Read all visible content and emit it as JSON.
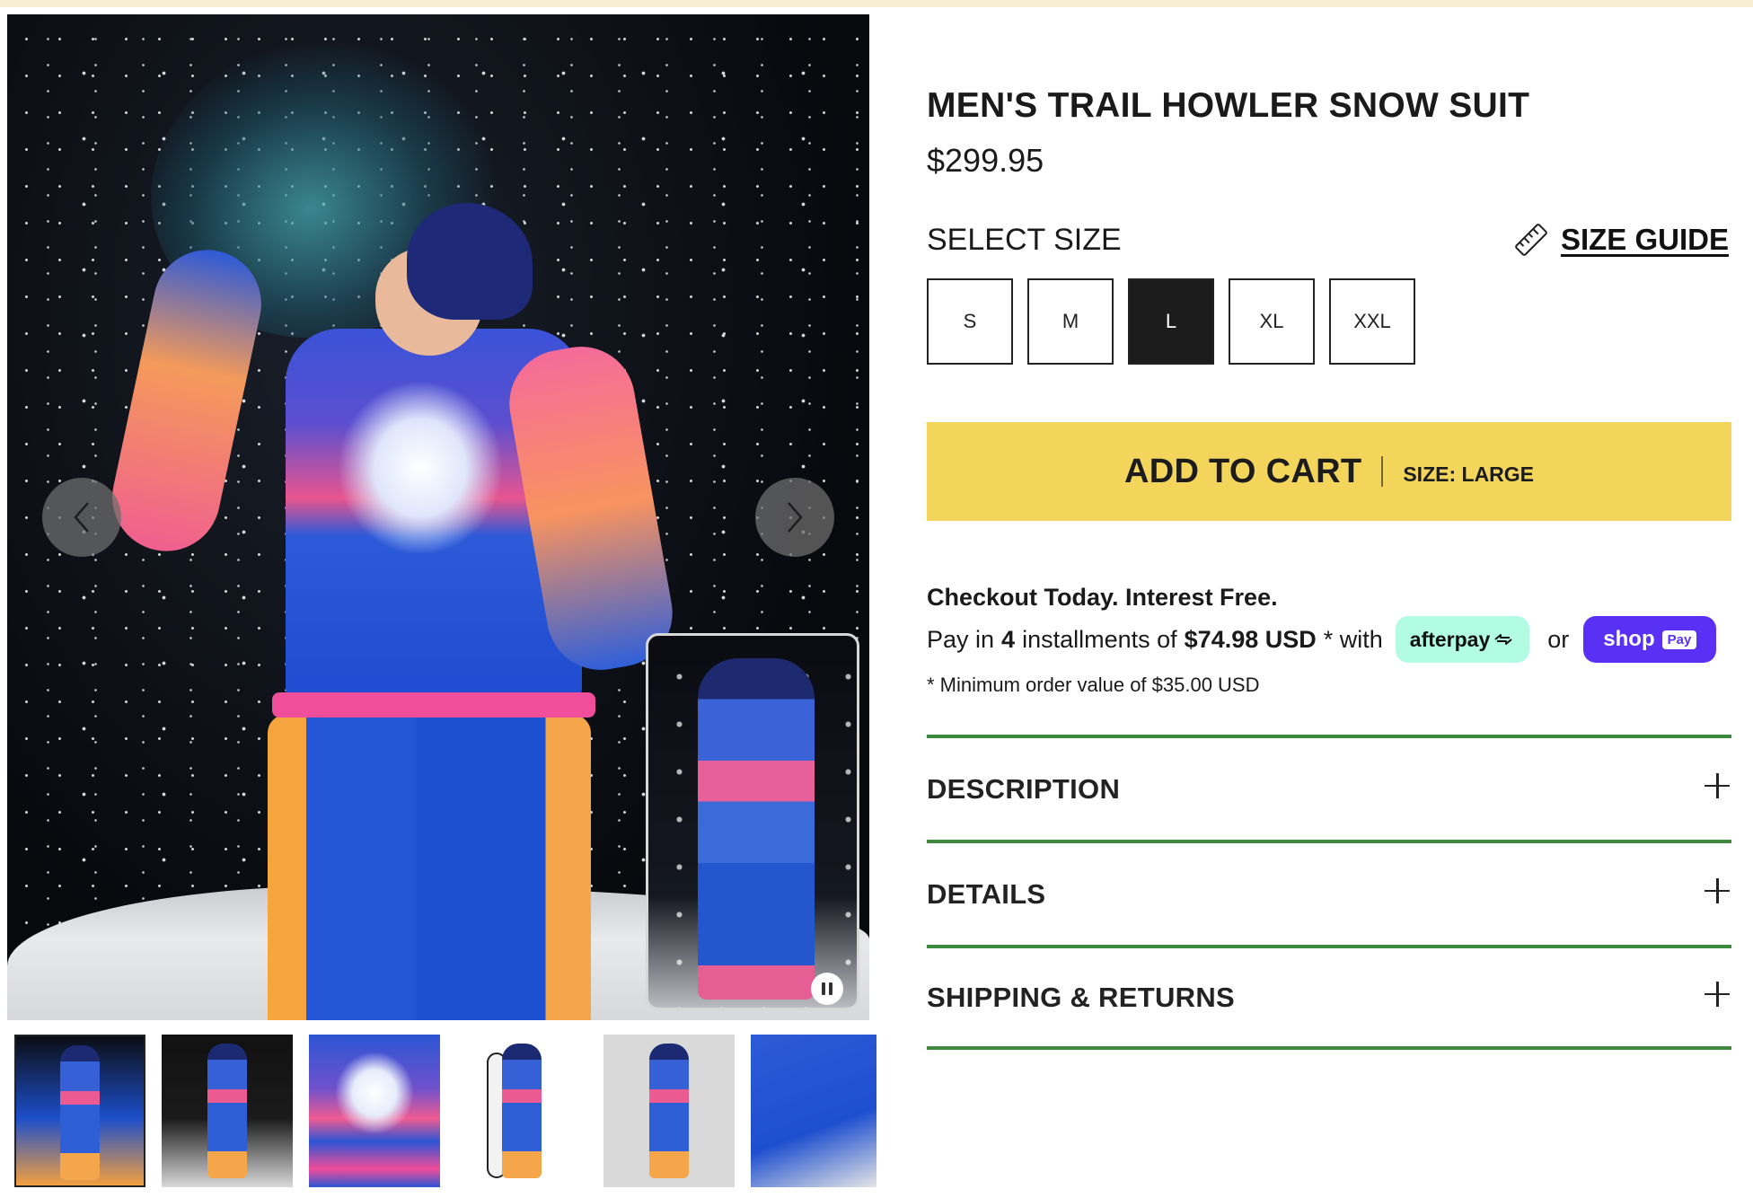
{
  "product": {
    "title": "MEN'S TRAIL HOWLER SNOW SUIT",
    "price": "$299.95"
  },
  "size_selector": {
    "label": "SELECT SIZE",
    "guide_label": "SIZE GUIDE",
    "options": [
      "S",
      "M",
      "L",
      "XL",
      "XXL"
    ],
    "selected": "L"
  },
  "cart": {
    "button_label": "ADD TO CART",
    "size_label": "SIZE: LARGE"
  },
  "payment": {
    "headline": "Checkout Today. Interest Free.",
    "text_before_count": "Pay in",
    "installment_count": "4",
    "text_before_amount": "installments of",
    "installment_amount": "$74.98 USD",
    "text_after_amount": "* with",
    "afterpay_label": "afterpay",
    "or_text": "or",
    "shoppay_label": "shop",
    "shoppay_pill": "Pay",
    "minimum_note": "* Minimum order value of $35.00 USD"
  },
  "accordion": [
    {
      "label": "DESCRIPTION"
    },
    {
      "label": "DETAILS"
    },
    {
      "label": "SHIPPING & RETURNS"
    }
  ],
  "gallery": {
    "thumbnail_count": 6,
    "active_thumbnail": 1
  },
  "colors": {
    "accent_yellow": "#f3d55c",
    "divider_green": "#3d8a3f",
    "afterpay_mint": "#b2fce4",
    "shoppay_purple": "#5a31f4",
    "selected_size_bg": "#1c1c1c"
  }
}
